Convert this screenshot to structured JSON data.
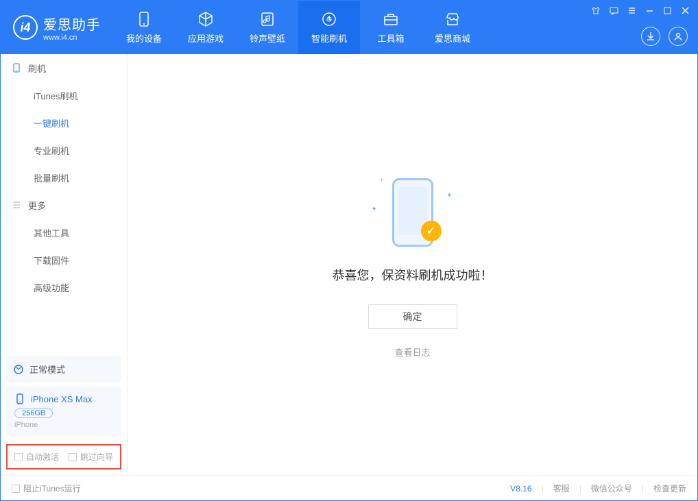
{
  "app": {
    "name": "爱思助手",
    "url": "www.i4.cn"
  },
  "nav": {
    "tabs": [
      {
        "label": "我的设备",
        "icon": "device"
      },
      {
        "label": "应用游戏",
        "icon": "cube"
      },
      {
        "label": "铃声壁纸",
        "icon": "music"
      },
      {
        "label": "智能刷机",
        "icon": "refresh",
        "active": true
      },
      {
        "label": "工具箱",
        "icon": "toolbox"
      },
      {
        "label": "爱思商城",
        "icon": "store"
      }
    ]
  },
  "sidebar": {
    "group1": {
      "title": "刷机",
      "items": [
        "iTunes刷机",
        "一键刷机",
        "专业刷机",
        "批量刷机"
      ],
      "activeIndex": 1
    },
    "group2": {
      "title": "更多",
      "items": [
        "其他工具",
        "下载固件",
        "高级功能"
      ]
    },
    "mode": "正常模式",
    "device": {
      "name": "iPhone XS Max",
      "capacity": "256GB",
      "type": "iPhone"
    },
    "checks": {
      "autoActivate": "自动激活",
      "skipGuide": "跳过向导"
    }
  },
  "main": {
    "success": "恭喜您，保资料刷机成功啦！",
    "ok": "确定",
    "viewLog": "查看日志"
  },
  "footer": {
    "blockItunes": "阻止iTunes运行",
    "version": "V8.16",
    "links": [
      "客服",
      "微信公众号",
      "检查更新"
    ]
  }
}
